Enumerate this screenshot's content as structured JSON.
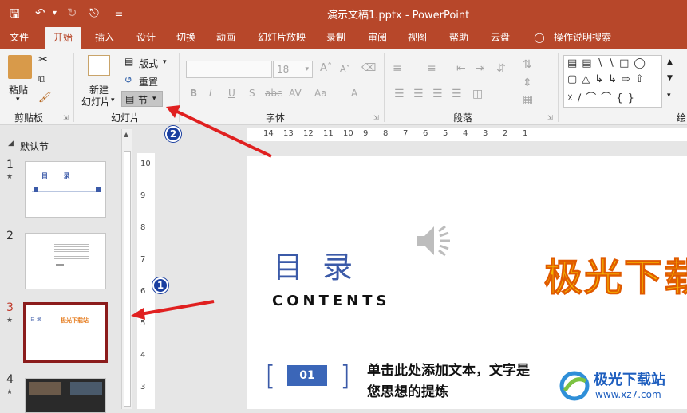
{
  "titlebar": {
    "doc_title": "演示文稿1.pptx  -  PowerPoint",
    "icons": [
      "save-icon",
      "undo-icon",
      "redo-icon",
      "present-icon",
      "customize-icon"
    ]
  },
  "tabs": [
    "文件",
    "开始",
    "插入",
    "设计",
    "切换",
    "动画",
    "幻灯片放映",
    "录制",
    "审阅",
    "视图",
    "帮助",
    "云盘"
  ],
  "tell_me": "操作说明搜索",
  "ribbon": {
    "clipboard": {
      "paste": "粘贴",
      "label": "剪贴板"
    },
    "slides": {
      "new_slide_line1": "新建",
      "new_slide_line2": "幻灯片",
      "layout": "版式",
      "reset": "重置",
      "section": "节",
      "label": "幻灯片"
    },
    "font": {
      "size": "18",
      "label": "字体"
    },
    "paragraph": {
      "label": "段落"
    },
    "drawing": {
      "label": "绘"
    }
  },
  "left_panel": {
    "section_name": "默认节",
    "slides": [
      {
        "num": "1",
        "star": "★"
      },
      {
        "num": "2",
        "star": ""
      },
      {
        "num": "3",
        "star": "★"
      },
      {
        "num": "4",
        "star": "★"
      }
    ],
    "thumb3": {
      "title": "目 录",
      "brand": "极光下载站"
    }
  },
  "hruler_labels": [
    "14",
    "13",
    "12",
    "11",
    "10",
    "9",
    "8",
    "7",
    "6",
    "5",
    "4",
    "3",
    "2",
    "1"
  ],
  "vruler_labels": [
    "10",
    "9",
    "8",
    "7",
    "6",
    "5",
    "4",
    "3"
  ],
  "slide": {
    "title": "目 录",
    "subtitle": "CONTENTS",
    "brand_text": "极光下载",
    "item_number": "01",
    "item_text_line1": "单击此处添加文本，文字是",
    "item_text_line2": "您思想的提炼"
  },
  "watermark": {
    "name": "极光下载站",
    "url": "www.xz7.com"
  },
  "annotations": {
    "badge1": "1",
    "badge2": "2",
    "arrow_color": "#e02020"
  }
}
